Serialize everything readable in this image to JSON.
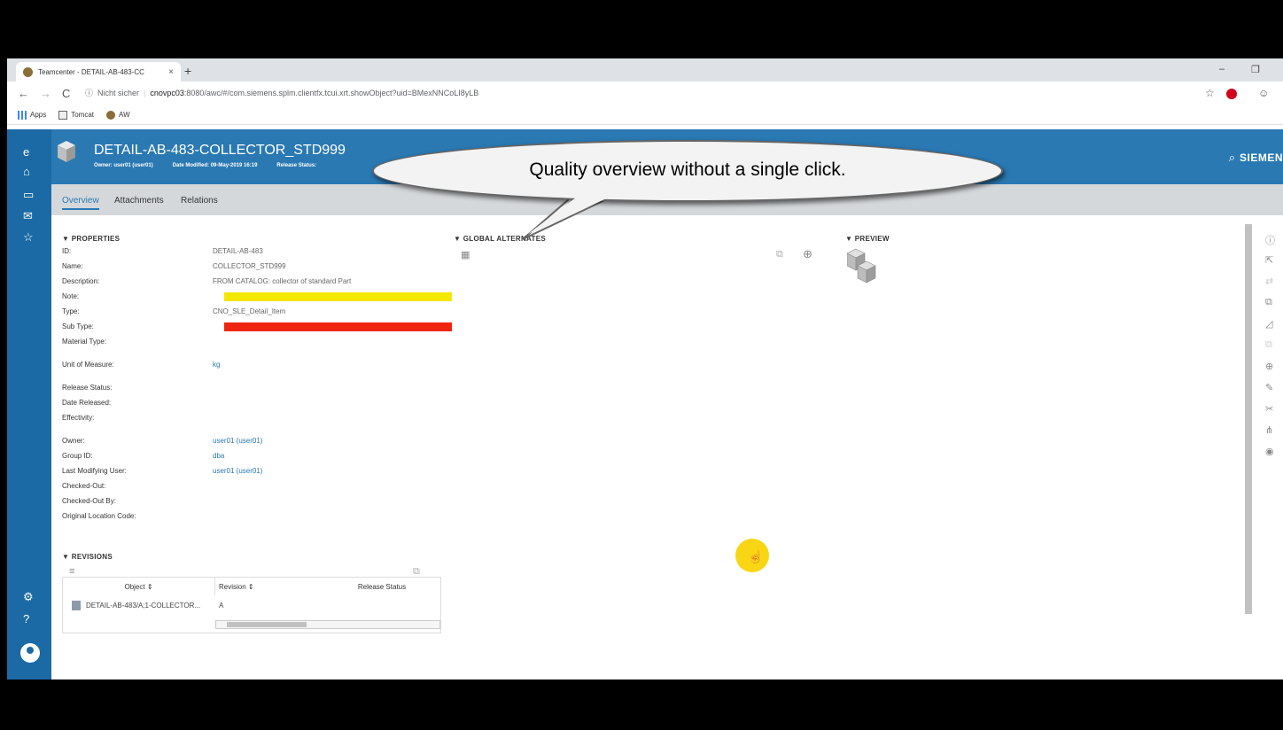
{
  "browser": {
    "tab_title": "Teamcenter - DETAIL-AB-483-CC",
    "tab_close": "×",
    "new_tab": "+",
    "security": "Nicht sicher",
    "url_host": "cnovpc03",
    "url_rest": ":8080/awc/#/com.siemens.splm.clientfx.tcui.xrt.showObject?uid=BMexNNCoLI8yLB",
    "bookmarks": [
      "Apps",
      "Tomcat",
      "AW"
    ]
  },
  "header": {
    "title": "DETAIL-AB-483-COLLECTOR_STD999",
    "owner": "Owner: user01 (user01)",
    "date_modified": "Date Modified: 09-May-2019 16:19",
    "release_status": "Release Status:",
    "brand": "SIEMEN"
  },
  "tabs": [
    "Overview",
    "Attachments",
    "Relations"
  ],
  "properties": {
    "heading": "PROPERTIES",
    "rows": [
      {
        "label": "ID:",
        "value": "DETAIL-AB-483"
      },
      {
        "label": "Name:",
        "value": "COLLECTOR_STD999"
      },
      {
        "label": "Description:",
        "value": "FROM CATALOG: collector of standard Part"
      },
      {
        "label": "Note:",
        "value": ""
      },
      {
        "label": "Type:",
        "value": "CNO_SLE_Detail_Item"
      },
      {
        "label": "Sub Type:",
        "value": ""
      },
      {
        "label": "Material Type:",
        "value": ""
      },
      {
        "label": "Unit of Measure:",
        "value": "kg"
      },
      {
        "label": "Release Status:",
        "value": ""
      },
      {
        "label": "Date Released:",
        "value": ""
      },
      {
        "label": "Effectivity:",
        "value": ""
      },
      {
        "label": "Owner:",
        "value": "user01 (user01)"
      },
      {
        "label": "Group ID:",
        "value": "dba"
      },
      {
        "label": "Last Modifying User:",
        "value": "user01 (user01)"
      },
      {
        "label": "Checked-Out:",
        "value": ""
      },
      {
        "label": "Checked-Out By:",
        "value": ""
      },
      {
        "label": "Original Location Code:",
        "value": ""
      }
    ],
    "note_color": "#f5e800",
    "subtype_color": "#f0250f"
  },
  "global_alternates": {
    "heading": "GLOBAL ALTERNATES"
  },
  "preview": {
    "heading": "PREVIEW"
  },
  "revisions": {
    "heading": "REVISIONS",
    "columns": [
      "Object",
      "Revision",
      "Release Status"
    ],
    "rows": [
      {
        "object": "DETAIL-AB-483/A;1-COLLECTOR...",
        "revision": "A",
        "release_status": ""
      }
    ]
  },
  "callout": {
    "text": "Quality overview without a single click."
  },
  "colors": {
    "nav": "#1b6aa5",
    "header": "#2a79b3",
    "subnav": "#d5d8db"
  }
}
